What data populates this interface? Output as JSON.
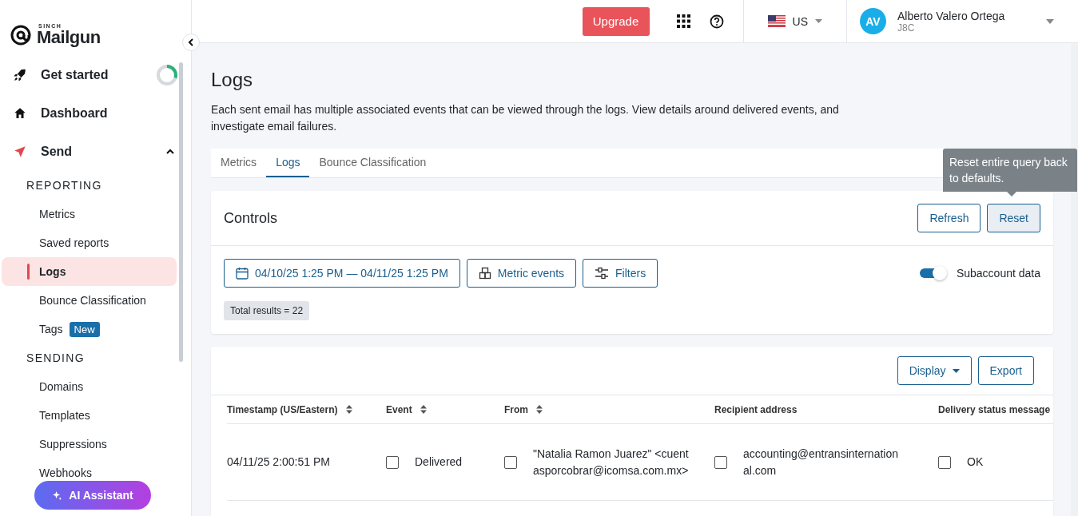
{
  "brand": {
    "over": "SINCH",
    "name": "Mailgun"
  },
  "sidebar": {
    "items": [
      {
        "kind": "nav",
        "label": "Get started",
        "level": 0.3
      },
      {
        "kind": "nav",
        "label": "Dashboard"
      },
      {
        "kind": "nav",
        "label": "Send",
        "expanded": true
      },
      {
        "kind": "section",
        "label": "REPORTING"
      },
      {
        "kind": "sub",
        "label": "Metrics",
        "selected": false
      },
      {
        "kind": "sub",
        "label": "Saved reports",
        "selected": false
      },
      {
        "kind": "sub",
        "label": "Logs",
        "selected": true
      },
      {
        "kind": "sub",
        "label": "Bounce Classification",
        "selected": false
      },
      {
        "kind": "sub",
        "label": "Tags",
        "badge": "New",
        "selected": false
      },
      {
        "kind": "section",
        "label": "SENDING"
      },
      {
        "kind": "sub",
        "label": "Domains",
        "selected": false
      },
      {
        "kind": "sub",
        "label": "Templates",
        "selected": false
      },
      {
        "kind": "sub",
        "label": "Suppressions",
        "selected": false
      },
      {
        "kind": "sub",
        "label": "Webhooks",
        "selected": false
      }
    ],
    "assistant": "AI Assistant"
  },
  "header": {
    "upgrade": "Upgrade",
    "region": "US",
    "user": {
      "initials": "AV",
      "name": "Alberto Valero Ortega",
      "account": "J8C"
    }
  },
  "page": {
    "title": "Logs",
    "description": "Each sent email has multiple associated events that can be viewed through the logs. View details around delivered events, and investigate email failures.",
    "tabs": [
      {
        "label": "Metrics",
        "selected": false
      },
      {
        "label": "Logs",
        "selected": true
      },
      {
        "label": "Bounce Classification",
        "selected": false
      }
    ],
    "tooltip": "Reset entire query back to defaults."
  },
  "controls": {
    "title": "Controls",
    "buttons": [
      "Refresh",
      "Reset"
    ],
    "date_range": "04/10/25 1:25 PM — 04/11/25 1:25 PM",
    "metric_events": "Metric events",
    "filters": "Filters",
    "subaccount": {
      "label": "Subaccount data",
      "on": true
    },
    "total": "Total results = 22"
  },
  "logs": {
    "display": "Display",
    "export": "Export",
    "columns": [
      {
        "label": "Timestamp (US/Eastern)",
        "sortable": true
      },
      {
        "label": "Event",
        "sortable": true
      },
      {
        "label": "From",
        "sortable": true
      },
      {
        "label": "Recipient address",
        "sortable": false
      },
      {
        "label": "Delivery status message",
        "sortable": false
      }
    ],
    "rows": [
      [
        {
          "text": "04/11/25 2:00:51 PM"
        },
        {
          "text": "Delivered",
          "checked": false
        },
        {
          "text": "\"Natalia Ramon Juarez\" <cuentasporcobrar@icomsa.com.mx>",
          "checked": false
        },
        {
          "text": "accounting@entransinternational.com",
          "checked": false
        },
        {
          "text": "OK",
          "checked": false
        }
      ]
    ]
  }
}
